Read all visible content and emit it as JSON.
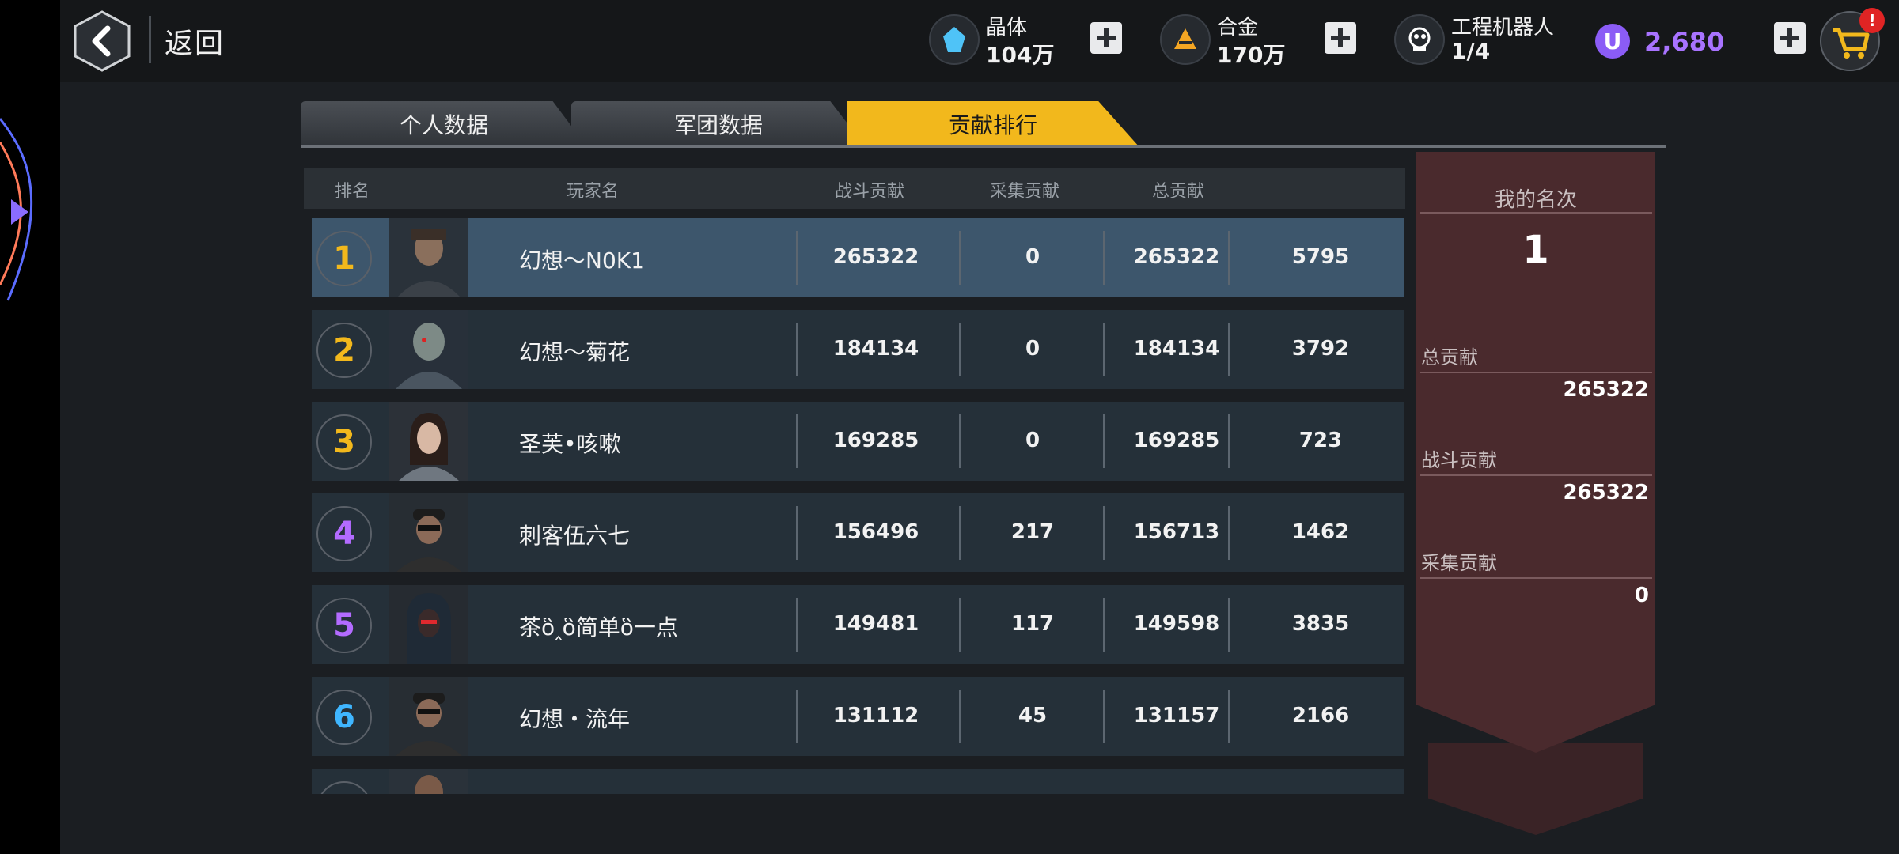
{
  "header": {
    "back_label": "返回",
    "resources": [
      {
        "name": "晶体",
        "value": "104万",
        "icon": "crystal-icon",
        "color": "#4fc3f7"
      },
      {
        "name": "合金",
        "value": "170万",
        "icon": "alloy-icon",
        "color": "#f5a623"
      },
      {
        "name": "工程机器人",
        "value": "1/4",
        "icon": "robot-icon",
        "color": "#ffffff"
      }
    ],
    "currency": {
      "symbol": "U",
      "value": "2,680",
      "color": "#a873ff"
    },
    "cart_badge": "!"
  },
  "tabs": [
    {
      "label": "个人数据",
      "active": false
    },
    {
      "label": "军团数据",
      "active": false
    },
    {
      "label": "贡献排行",
      "active": true
    }
  ],
  "table": {
    "headers": [
      "排名",
      "玩家名",
      "战斗贡献",
      "采集贡献",
      "总贡献"
    ],
    "rows": [
      {
        "rank": "1",
        "name": "幻想～N0K1",
        "combat": "265322",
        "gather": "0",
        "total": "265322",
        "extra": "5795",
        "rank_color": "#f2b81c"
      },
      {
        "rank": "2",
        "name": "幻想～菊花",
        "combat": "184134",
        "gather": "0",
        "total": "184134",
        "extra": "3792",
        "rank_color": "#f2b81c"
      },
      {
        "rank": "3",
        "name": "圣芙•咳嗽",
        "combat": "169285",
        "gather": "0",
        "total": "169285",
        "extra": "723",
        "rank_color": "#f2b81c"
      },
      {
        "rank": "4",
        "name": "刺客伍六七",
        "combat": "156496",
        "gather": "217",
        "total": "156713",
        "extra": "1462",
        "rank_color": "#b36bff"
      },
      {
        "rank": "5",
        "name": "茶ὃ‸ὃ简单ὃ一点",
        "combat": "149481",
        "gather": "117",
        "total": "149598",
        "extra": "3835",
        "rank_color": "#b36bff"
      },
      {
        "rank": "6",
        "name": "幻想・流年",
        "combat": "131112",
        "gather": "45",
        "total": "131157",
        "extra": "2166",
        "rank_color": "#3fb6ff"
      }
    ]
  },
  "my_rank_panel": {
    "title": "我的名次",
    "rank": "1",
    "total_label": "总贡献",
    "total_value": "265322",
    "combat_label": "战斗贡献",
    "combat_value": "265322",
    "gather_label": "采集贡献",
    "gather_value": "0"
  }
}
